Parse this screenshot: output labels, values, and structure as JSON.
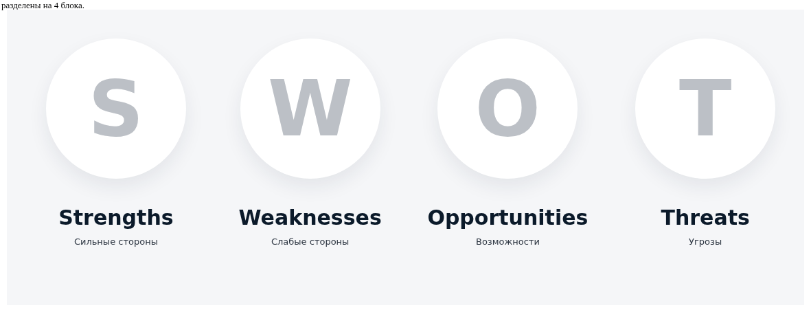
{
  "intro_text": "разделены на 4 блока.",
  "blocks": [
    {
      "letter": "S",
      "title": "Strengths",
      "subtitle": "Сильные стороны"
    },
    {
      "letter": "W",
      "title": "Weaknesses",
      "subtitle": "Слабые стороны"
    },
    {
      "letter": "O",
      "title": "Opportunities",
      "subtitle": "Возможности"
    },
    {
      "letter": "T",
      "title": "Threats",
      "subtitle": "Угрозы"
    }
  ]
}
